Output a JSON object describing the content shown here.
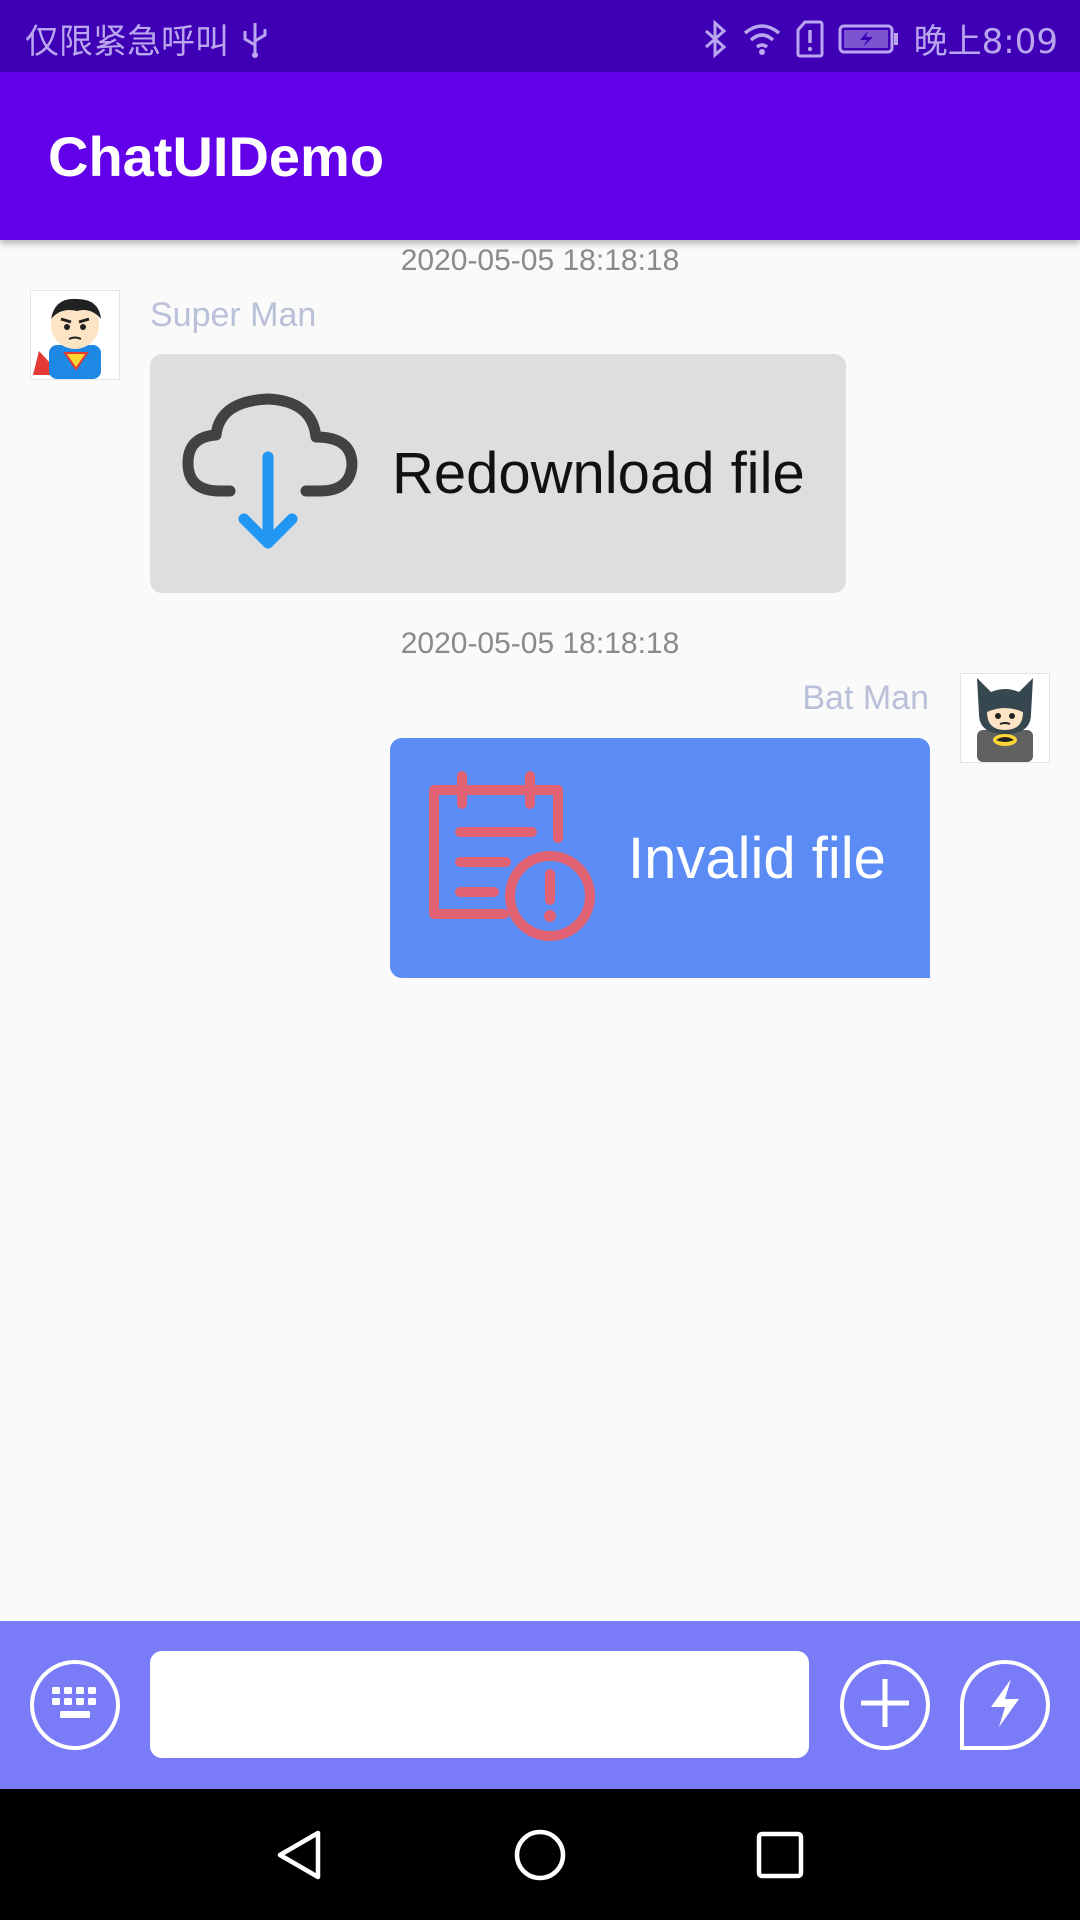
{
  "status_bar": {
    "carrier_text": "仅限紧急呼叫",
    "time": "晚上8:09",
    "icons": [
      "usb-icon",
      "bluetooth-icon",
      "wifi-icon",
      "sim-alert-icon",
      "battery-charging-icon"
    ]
  },
  "app_bar": {
    "title": "ChatUIDemo"
  },
  "messages": [
    {
      "timestamp": "2020-05-05 18:18:18",
      "sender": "Super Man",
      "side": "left",
      "avatar": "superman-avatar",
      "file_icon": "cloud-download-icon",
      "file_label": "Redownload file"
    },
    {
      "timestamp": "2020-05-05 18:18:18",
      "sender": "Bat Man",
      "side": "right",
      "avatar": "batman-avatar",
      "file_icon": "invalid-file-icon",
      "file_label": "Invalid file"
    }
  ],
  "input_bar": {
    "message_value": "",
    "buttons": [
      "keyboard-icon",
      "plus-circle-icon",
      "lightning-icon"
    ]
  },
  "nav_bar": {
    "buttons": [
      "back-icon",
      "home-icon",
      "recents-icon"
    ]
  },
  "colors": {
    "status_bar": "#3f00b5",
    "app_bar": "#6200ea",
    "bubble_left": "#dedede",
    "bubble_right": "#5b8cf6",
    "input_bar": "#7a7cf7",
    "sender_name": "#b9c0d8",
    "invalid_icon": "#e06272",
    "download_arrow": "#2196f3"
  }
}
